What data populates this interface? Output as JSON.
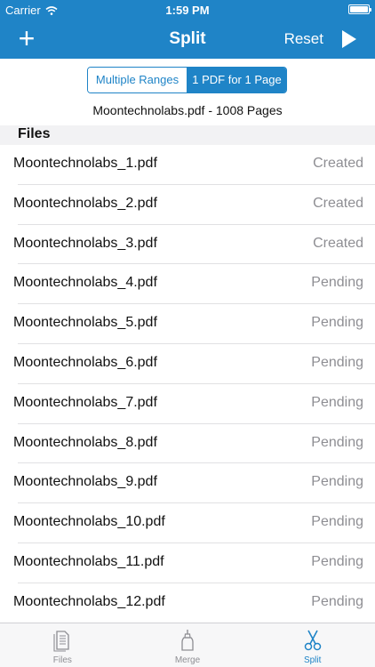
{
  "status_bar": {
    "carrier": "Carrier",
    "time": "1:59 PM"
  },
  "nav": {
    "title": "Split",
    "add_label": "+",
    "reset_label": "Reset"
  },
  "mode": {
    "options": [
      "Multiple Ranges",
      "1 PDF for 1 Page"
    ],
    "selected": "1 PDF for 1 Page"
  },
  "file_info": "Moontechnolabs.pdf - 1008 Pages",
  "section_title": "Files",
  "files": [
    {
      "name": "Moontechnolabs_1.pdf",
      "status": "Created"
    },
    {
      "name": "Moontechnolabs_2.pdf",
      "status": "Created"
    },
    {
      "name": "Moontechnolabs_3.pdf",
      "status": "Created"
    },
    {
      "name": "Moontechnolabs_4.pdf",
      "status": "Pending"
    },
    {
      "name": "Moontechnolabs_5.pdf",
      "status": "Pending"
    },
    {
      "name": "Moontechnolabs_6.pdf",
      "status": "Pending"
    },
    {
      "name": "Moontechnolabs_7.pdf",
      "status": "Pending"
    },
    {
      "name": "Moontechnolabs_8.pdf",
      "status": "Pending"
    },
    {
      "name": "Moontechnolabs_9.pdf",
      "status": "Pending"
    },
    {
      "name": "Moontechnolabs_10.pdf",
      "status": "Pending"
    },
    {
      "name": "Moontechnolabs_11.pdf",
      "status": "Pending"
    },
    {
      "name": "Moontechnolabs_12.pdf",
      "status": "Pending"
    }
  ],
  "tabs": [
    {
      "label": "Files",
      "icon": "document-icon",
      "active": false
    },
    {
      "label": "Merge",
      "icon": "glue-bottle-icon",
      "active": false
    },
    {
      "label": "Split",
      "icon": "scissors-icon",
      "active": true
    }
  ],
  "colors": {
    "accent": "#1f84c7",
    "secondary_text": "#8e8e93"
  }
}
